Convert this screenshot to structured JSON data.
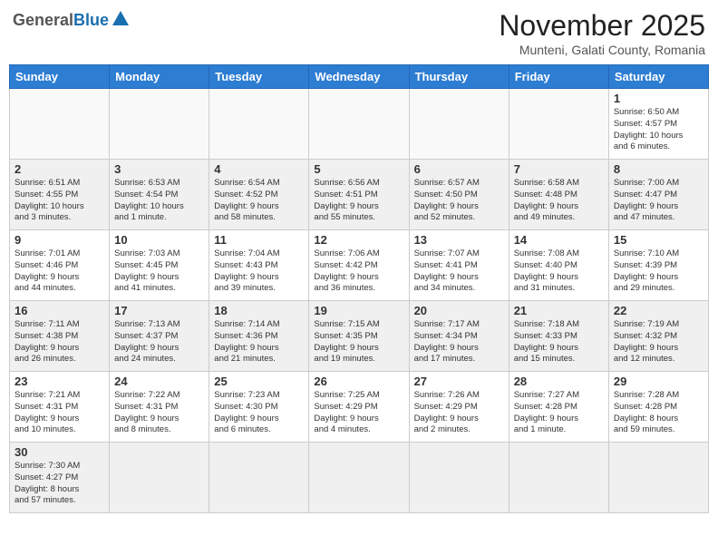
{
  "header": {
    "logo_general": "General",
    "logo_blue": "Blue",
    "month_title": "November 2025",
    "location": "Munteni, Galati County, Romania"
  },
  "weekdays": [
    "Sunday",
    "Monday",
    "Tuesday",
    "Wednesday",
    "Thursday",
    "Friday",
    "Saturday"
  ],
  "weeks": [
    [
      {
        "day": "",
        "info": ""
      },
      {
        "day": "",
        "info": ""
      },
      {
        "day": "",
        "info": ""
      },
      {
        "day": "",
        "info": ""
      },
      {
        "day": "",
        "info": ""
      },
      {
        "day": "",
        "info": ""
      },
      {
        "day": "1",
        "info": "Sunrise: 6:50 AM\nSunset: 4:57 PM\nDaylight: 10 hours\nand 6 minutes."
      }
    ],
    [
      {
        "day": "2",
        "info": "Sunrise: 6:51 AM\nSunset: 4:55 PM\nDaylight: 10 hours\nand 3 minutes."
      },
      {
        "day": "3",
        "info": "Sunrise: 6:53 AM\nSunset: 4:54 PM\nDaylight: 10 hours\nand 1 minute."
      },
      {
        "day": "4",
        "info": "Sunrise: 6:54 AM\nSunset: 4:52 PM\nDaylight: 9 hours\nand 58 minutes."
      },
      {
        "day": "5",
        "info": "Sunrise: 6:56 AM\nSunset: 4:51 PM\nDaylight: 9 hours\nand 55 minutes."
      },
      {
        "day": "6",
        "info": "Sunrise: 6:57 AM\nSunset: 4:50 PM\nDaylight: 9 hours\nand 52 minutes."
      },
      {
        "day": "7",
        "info": "Sunrise: 6:58 AM\nSunset: 4:48 PM\nDaylight: 9 hours\nand 49 minutes."
      },
      {
        "day": "8",
        "info": "Sunrise: 7:00 AM\nSunset: 4:47 PM\nDaylight: 9 hours\nand 47 minutes."
      }
    ],
    [
      {
        "day": "9",
        "info": "Sunrise: 7:01 AM\nSunset: 4:46 PM\nDaylight: 9 hours\nand 44 minutes."
      },
      {
        "day": "10",
        "info": "Sunrise: 7:03 AM\nSunset: 4:45 PM\nDaylight: 9 hours\nand 41 minutes."
      },
      {
        "day": "11",
        "info": "Sunrise: 7:04 AM\nSunset: 4:43 PM\nDaylight: 9 hours\nand 39 minutes."
      },
      {
        "day": "12",
        "info": "Sunrise: 7:06 AM\nSunset: 4:42 PM\nDaylight: 9 hours\nand 36 minutes."
      },
      {
        "day": "13",
        "info": "Sunrise: 7:07 AM\nSunset: 4:41 PM\nDaylight: 9 hours\nand 34 minutes."
      },
      {
        "day": "14",
        "info": "Sunrise: 7:08 AM\nSunset: 4:40 PM\nDaylight: 9 hours\nand 31 minutes."
      },
      {
        "day": "15",
        "info": "Sunrise: 7:10 AM\nSunset: 4:39 PM\nDaylight: 9 hours\nand 29 minutes."
      }
    ],
    [
      {
        "day": "16",
        "info": "Sunrise: 7:11 AM\nSunset: 4:38 PM\nDaylight: 9 hours\nand 26 minutes."
      },
      {
        "day": "17",
        "info": "Sunrise: 7:13 AM\nSunset: 4:37 PM\nDaylight: 9 hours\nand 24 minutes."
      },
      {
        "day": "18",
        "info": "Sunrise: 7:14 AM\nSunset: 4:36 PM\nDaylight: 9 hours\nand 21 minutes."
      },
      {
        "day": "19",
        "info": "Sunrise: 7:15 AM\nSunset: 4:35 PM\nDaylight: 9 hours\nand 19 minutes."
      },
      {
        "day": "20",
        "info": "Sunrise: 7:17 AM\nSunset: 4:34 PM\nDaylight: 9 hours\nand 17 minutes."
      },
      {
        "day": "21",
        "info": "Sunrise: 7:18 AM\nSunset: 4:33 PM\nDaylight: 9 hours\nand 15 minutes."
      },
      {
        "day": "22",
        "info": "Sunrise: 7:19 AM\nSunset: 4:32 PM\nDaylight: 9 hours\nand 12 minutes."
      }
    ],
    [
      {
        "day": "23",
        "info": "Sunrise: 7:21 AM\nSunset: 4:31 PM\nDaylight: 9 hours\nand 10 minutes."
      },
      {
        "day": "24",
        "info": "Sunrise: 7:22 AM\nSunset: 4:31 PM\nDaylight: 9 hours\nand 8 minutes."
      },
      {
        "day": "25",
        "info": "Sunrise: 7:23 AM\nSunset: 4:30 PM\nDaylight: 9 hours\nand 6 minutes."
      },
      {
        "day": "26",
        "info": "Sunrise: 7:25 AM\nSunset: 4:29 PM\nDaylight: 9 hours\nand 4 minutes."
      },
      {
        "day": "27",
        "info": "Sunrise: 7:26 AM\nSunset: 4:29 PM\nDaylight: 9 hours\nand 2 minutes."
      },
      {
        "day": "28",
        "info": "Sunrise: 7:27 AM\nSunset: 4:28 PM\nDaylight: 9 hours\nand 1 minute."
      },
      {
        "day": "29",
        "info": "Sunrise: 7:28 AM\nSunset: 4:28 PM\nDaylight: 8 hours\nand 59 minutes."
      }
    ],
    [
      {
        "day": "30",
        "info": "Sunrise: 7:30 AM\nSunset: 4:27 PM\nDaylight: 8 hours\nand 57 minutes."
      },
      {
        "day": "",
        "info": ""
      },
      {
        "day": "",
        "info": ""
      },
      {
        "day": "",
        "info": ""
      },
      {
        "day": "",
        "info": ""
      },
      {
        "day": "",
        "info": ""
      },
      {
        "day": "",
        "info": ""
      }
    ]
  ]
}
